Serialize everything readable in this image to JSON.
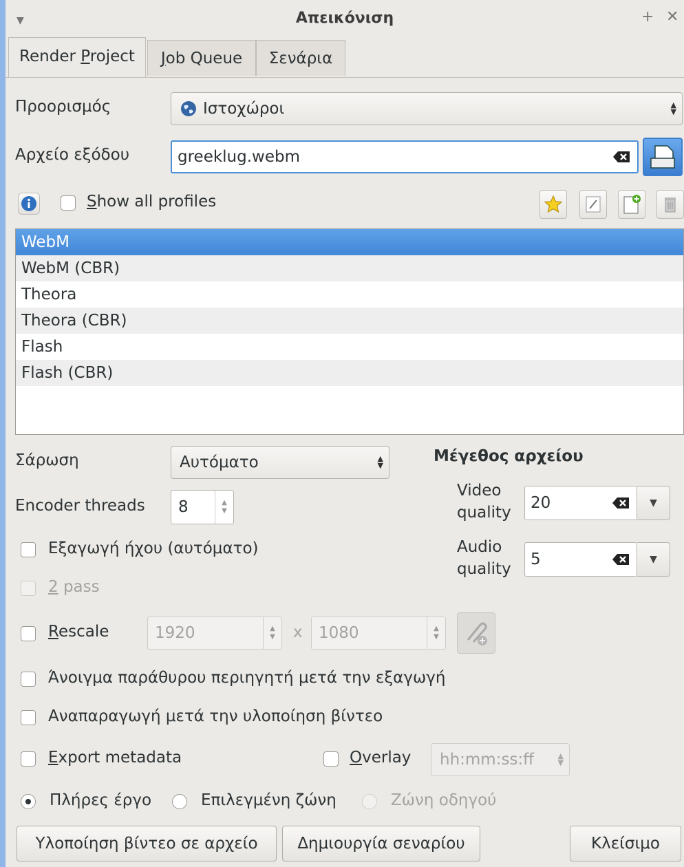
{
  "window": {
    "title": "Απεικόνιση",
    "menu_icon": "chevron-down-icon",
    "float_icon": "+",
    "close_icon": "✕"
  },
  "tabs": [
    {
      "label": "Render Project",
      "active": true
    },
    {
      "label": "Job Queue",
      "active": false
    },
    {
      "label": "Σενάρια",
      "active": false
    }
  ],
  "destination": {
    "label": "Προορισμός",
    "value": "Ιστοχώροι"
  },
  "output_file": {
    "label": "Αρχείο εξόδου",
    "value": "greeklug.webm"
  },
  "profiles": {
    "show_all_label": "Show all profiles",
    "show_all_checked": false,
    "items": [
      "WebM",
      "WebM (CBR)",
      "Theora",
      "Theora (CBR)",
      "Flash",
      "Flash (CBR)"
    ],
    "selected_index": 0
  },
  "scan": {
    "label": "Σάρωση",
    "value": "Αυτόματο"
  },
  "encoder_threads": {
    "label": "Encoder threads",
    "value": "8"
  },
  "file_size": {
    "heading": "Μέγεθος αρχείου",
    "video_label_1": "Video",
    "video_label_2": "quality",
    "video_value": "20",
    "audio_label_1": "Audio",
    "audio_label_2": "quality",
    "audio_value": "5"
  },
  "export_audio": {
    "label": "Εξαγωγή ήχου (αυτόματο)",
    "checked": false
  },
  "two_pass": {
    "label": "2 pass",
    "checked": false,
    "enabled": false
  },
  "rescale": {
    "label": "Rescale",
    "width": "1920",
    "sep": "x",
    "height": "1080"
  },
  "open_browser": {
    "label": "Άνοιγμα παράθυρου περιηγητή μετά την εξαγωγή"
  },
  "play_after": {
    "label": "Αναπαραγωγή μετά την υλοποίηση βίντεο"
  },
  "export_metadata": {
    "label": "Export metadata"
  },
  "overlay": {
    "label": "Overlay",
    "value": "hh:mm:ss:ff"
  },
  "range": {
    "full": "Πλήρες έργο",
    "selected": "Επιλεγμένη ζώνη",
    "guide": "Ζώνη οδηγού",
    "chosen": "full"
  },
  "buttons": {
    "render": "Υλοποίηση βίντεο σε αρχείο",
    "script": "Δημιουργία σεναρίου",
    "close": "Κλείσιμο"
  }
}
